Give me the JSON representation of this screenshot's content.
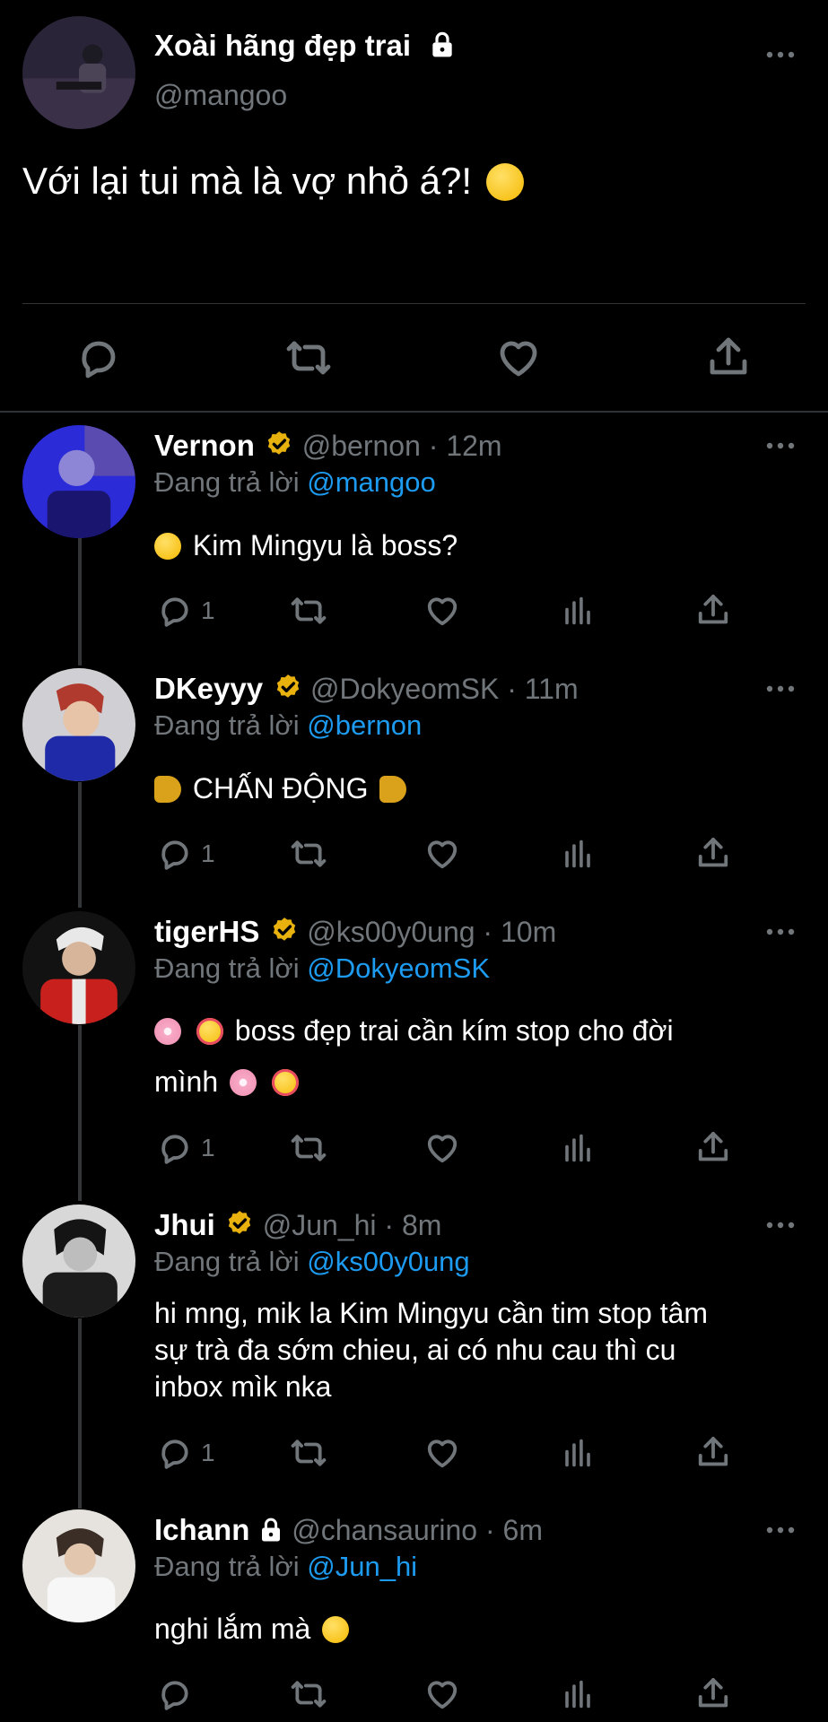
{
  "main_tweet": {
    "name": "Xoài hãng đẹp trai",
    "handle": "@mangoo",
    "text": "Với lại tui mà là vợ nhỏ á?!"
  },
  "replies": [
    {
      "name": "Vernon",
      "handle_time": "@bernon · 12m",
      "reply_prefix": "Đang trả lời",
      "reply_to": "@mangoo",
      "text": "Kim Mingyu là boss?",
      "reply_count": "1",
      "verified": true
    },
    {
      "name": "DKeyyy",
      "handle_time": "@DokyeomSK · 11m",
      "reply_prefix": "Đang trả lời",
      "reply_to": "@bernon",
      "text": "CHẤN ĐỘNG",
      "reply_count": "1",
      "verified": true
    },
    {
      "name": "tigerHS",
      "handle_time": "@ks00y0ung · 10m",
      "reply_prefix": "Đang trả lời",
      "reply_to": "@DokyeomSK",
      "text_line1": "boss đẹp trai cần kím stop cho đời",
      "text_line2": "mình",
      "reply_count": "1",
      "verified": true
    },
    {
      "name": "Jhui",
      "handle_time": "@Jun_hi · 8m",
      "reply_prefix": "Đang trả lời",
      "reply_to": "@ks00y0ung",
      "text_line1": "hi mng, mik la Kim Mingyu cần tim stop tâm",
      "text_line2": "sự trà đa sớm chieu, ai có nhu cau thì cu",
      "text_line3": "inbox mìk nka",
      "reply_count": "1",
      "verified": true
    },
    {
      "name": "Ichann",
      "handle_time": "@chansaurino · 6m",
      "reply_prefix": "Đang trả lời",
      "reply_to": "@Jun_hi",
      "text": "nghi lắm mà",
      "reply_count": "",
      "verified": false
    }
  ],
  "icons": [
    "reply-icon",
    "retweet-icon",
    "like-icon",
    "views-icon",
    "share-icon",
    "more-icon",
    "lock-icon",
    "verified-badge-icon"
  ],
  "colors": {
    "background": "#000000",
    "link": "#1d9bf0",
    "muted": "#71767b",
    "verified": "#e8b10e"
  }
}
